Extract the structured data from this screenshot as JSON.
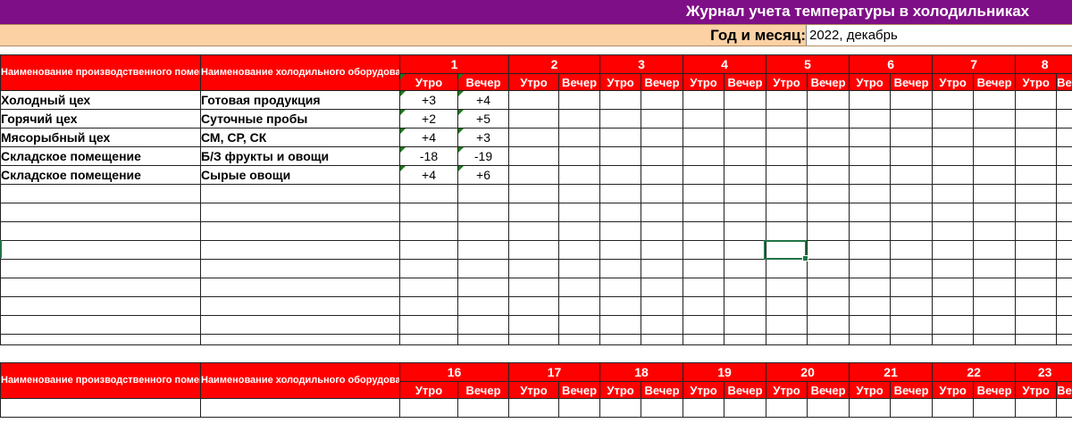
{
  "title": "Журнал учета температуры в холодильниках",
  "month": {
    "label": "Год и месяц:",
    "value": "2022, декабрь"
  },
  "headers": {
    "production_area": "Наименование производственного помещения",
    "fridge_equipment": "Наименование холодильного оборудования",
    "morning": "Утро",
    "evening": "Вечер"
  },
  "block1": {
    "days": [
      "1",
      "2",
      "3",
      "4",
      "5",
      "6",
      "7",
      "8"
    ],
    "rows": [
      {
        "area": "Холодный цех",
        "equipment": "Готовая продукция",
        "morning": "+3",
        "evening": "+4"
      },
      {
        "area": "Горячий цех",
        "equipment": "Суточные пробы",
        "morning": "+2",
        "evening": "+5"
      },
      {
        "area": "Мясорыбный цех",
        "equipment": "СМ, СР, СК",
        "morning": "+4",
        "evening": "+3"
      },
      {
        "area": "Складское помещение",
        "equipment": "Б/З фрукты и овощи",
        "morning": "-18",
        "evening": "-19"
      },
      {
        "area": "Складское помещение",
        "equipment": "Сырые овощи",
        "morning": "+4",
        "evening": "+6"
      }
    ],
    "empty_rows": 9
  },
  "block2": {
    "days": [
      "16",
      "17",
      "18",
      "19",
      "20",
      "21",
      "22",
      "23"
    ]
  }
}
